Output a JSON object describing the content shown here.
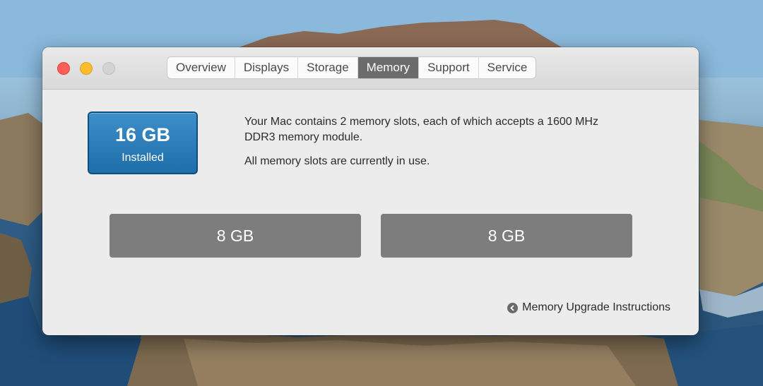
{
  "window": {
    "tabs": [
      {
        "label": "Overview"
      },
      {
        "label": "Displays"
      },
      {
        "label": "Storage"
      },
      {
        "label": "Memory"
      },
      {
        "label": "Support"
      },
      {
        "label": "Service"
      }
    ],
    "active_tab": "Memory"
  },
  "memory": {
    "installed_amount": "16 GB",
    "installed_label": "Installed",
    "description_line1": "Your Mac contains 2 memory slots, each of which accepts a 1600 MHz DDR3 memory module.",
    "description_line2": "All memory slots are currently in use.",
    "slots": [
      {
        "label": "8 GB"
      },
      {
        "label": "8 GB"
      }
    ],
    "upgrade_link": "Memory Upgrade Instructions"
  },
  "colors": {
    "close": "#fd5e57",
    "minimize": "#fdbc2e",
    "zoom": "#d3d3d3",
    "badge": "#1e6ea9",
    "active_tab": "#6b6b6b",
    "slot": "#7d7d7d"
  }
}
